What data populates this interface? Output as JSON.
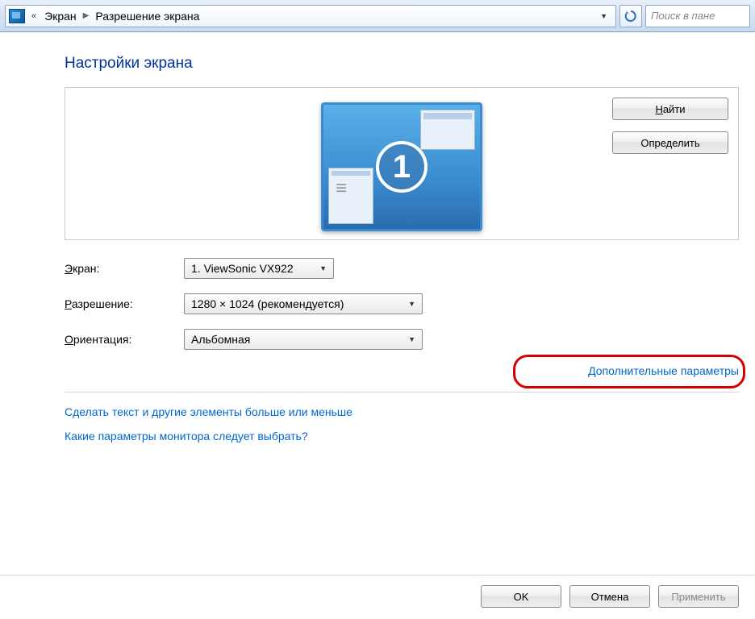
{
  "breadcrumb": {
    "item1": "Экран",
    "item2": "Разрешение экрана"
  },
  "search": {
    "placeholder": "Поиск в пане"
  },
  "header": "Настройки экрана",
  "monitor": {
    "number": "1"
  },
  "buttons": {
    "find": "Найти",
    "identify": "Определить",
    "ok": "OK",
    "cancel": "Отмена",
    "apply": "Применить"
  },
  "labels": {
    "display": "Экран:",
    "resolution": "Разрешение:",
    "orientation": "Ориентация:"
  },
  "selects": {
    "display": "1. ViewSonic VX922",
    "resolution": "1280 × 1024 (рекомендуется)",
    "orientation": "Альбомная"
  },
  "links": {
    "advanced": "Дополнительные параметры",
    "textsize": "Сделать текст и другие элементы больше или меньше",
    "whichsettings": "Какие параметры монитора следует выбрать?"
  }
}
